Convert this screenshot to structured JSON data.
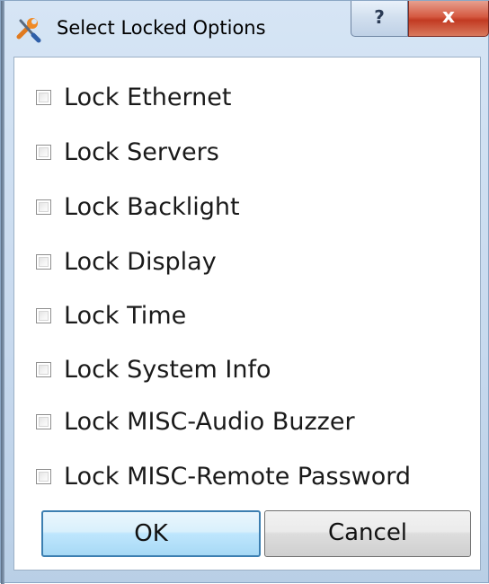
{
  "window": {
    "title": "Select Locked Options",
    "help_label": "?",
    "close_label": "x"
  },
  "options": [
    {
      "label": "Lock Ethernet",
      "checked": false
    },
    {
      "label": "Lock Servers",
      "checked": false
    },
    {
      "label": "Lock Backlight",
      "checked": false
    },
    {
      "label": "Lock Display",
      "checked": false
    },
    {
      "label": "Lock Time",
      "checked": false
    },
    {
      "label": "Lock System Info",
      "checked": false
    },
    {
      "label": "Lock MISC-Audio Buzzer",
      "checked": false
    },
    {
      "label": "Lock MISC-Remote Password",
      "checked": false
    }
  ],
  "buttons": {
    "ok_label": "OK",
    "cancel_label": "Cancel"
  },
  "icons": {
    "title_icon": "tools-icon",
    "help_icon": "help-icon",
    "close_icon": "close-icon"
  }
}
